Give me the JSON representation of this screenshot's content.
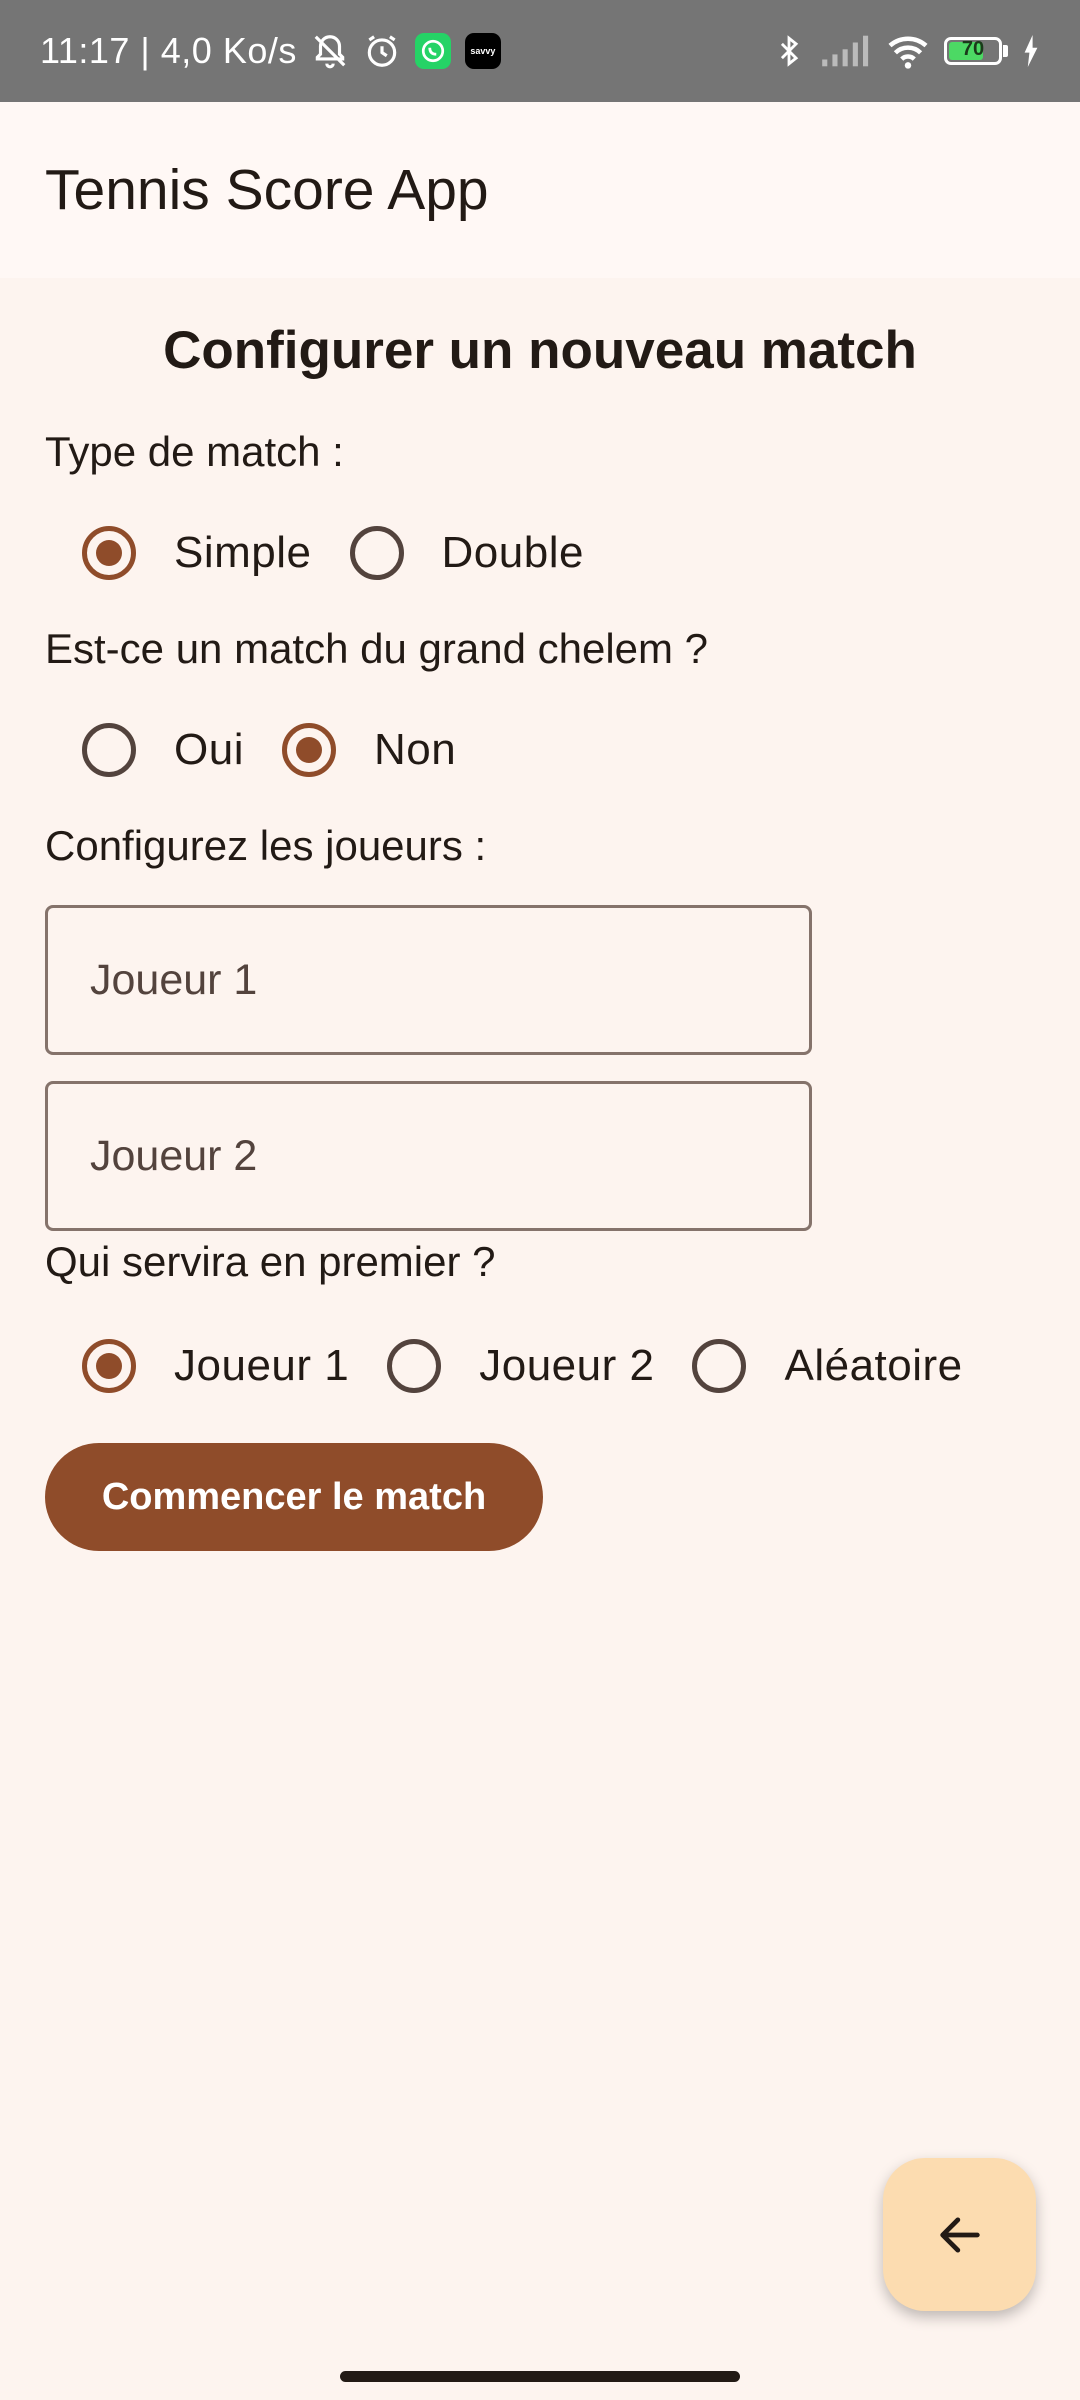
{
  "status_bar": {
    "time_speed": "11:17 | 4,0 Ko/s",
    "battery_level": "70",
    "battery_fraction": 0.7,
    "icons": [
      "mute-bell-icon",
      "alarm-icon",
      "whatsapp-icon",
      "app-badge-icon",
      "bluetooth-icon",
      "signal-icon",
      "wifi-icon",
      "battery-icon",
      "charging-icon"
    ],
    "app_badge_text": "savvy"
  },
  "app_bar": {
    "title": "Tennis Score App"
  },
  "form": {
    "heading": "Configurer un nouveau match",
    "match_type": {
      "label": "Type de match :",
      "options": [
        "Simple",
        "Double"
      ],
      "selected": "Simple"
    },
    "grand_slam": {
      "label": "Est-ce un match du grand chelem ?",
      "options": [
        "Oui",
        "Non"
      ],
      "selected": "Non"
    },
    "players": {
      "label": "Configurez les joueurs :",
      "player1": {
        "placeholder": "Joueur 1",
        "value": ""
      },
      "player2": {
        "placeholder": "Joueur 2",
        "value": ""
      }
    },
    "first_server": {
      "label": "Qui servira en premier ?",
      "options": [
        "Joueur 1",
        "Joueur 2",
        "Aléatoire"
      ],
      "selected": "Joueur 1"
    },
    "start_button": "Commencer le match"
  },
  "fab": {
    "icon": "arrow-back-icon"
  },
  "colors": {
    "primary": "#8f4c2a",
    "background": "#fdf4ef",
    "fab": "#fcdcb0",
    "status_bar": "#757575"
  }
}
